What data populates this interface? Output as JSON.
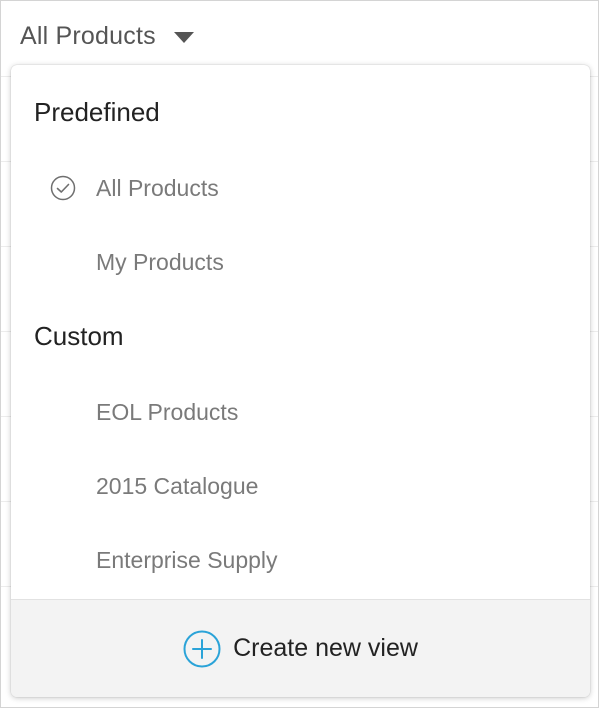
{
  "header": {
    "view_selector_label": "All Products",
    "caret_icon": "caret-down-icon"
  },
  "dropdown": {
    "sections": [
      {
        "title": "Predefined",
        "items": [
          {
            "label": "All Products",
            "selected": true
          },
          {
            "label": "My Products",
            "selected": false
          }
        ]
      },
      {
        "title": "Custom",
        "items": [
          {
            "label": "EOL Products",
            "selected": false
          },
          {
            "label": "2015 Catalogue",
            "selected": false
          },
          {
            "label": "Enterprise Supply",
            "selected": false
          }
        ]
      }
    ],
    "footer": {
      "label": "Create new view",
      "icon": "plus-circle-icon"
    }
  },
  "colors": {
    "accent": "#2aa3d8",
    "section_title": "#222222",
    "item_text": "#7a7a7a",
    "footer_bg": "#f3f3f3"
  }
}
